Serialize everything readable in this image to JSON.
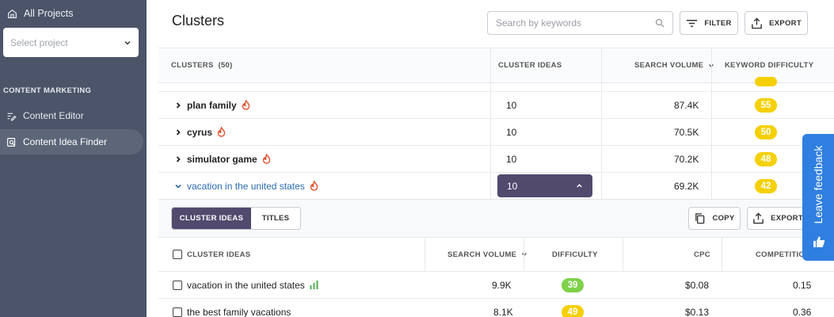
{
  "sidebar": {
    "all_projects": "All Projects",
    "select_project_placeholder": "Select project",
    "section": "CONTENT MARKETING",
    "items": [
      {
        "label": "Content Editor",
        "icon": "edit-lines-icon"
      },
      {
        "label": "Content Idea Finder",
        "icon": "search-doc-icon",
        "active": true
      }
    ]
  },
  "header": {
    "title": "Clusters",
    "search_placeholder": "Search by keywords",
    "filter_label": "FILTER",
    "export_label": "EXPORT"
  },
  "clusters_table": {
    "headers": {
      "clusters": "CLUSTERS",
      "count": "(50)",
      "cluster_ideas": "CLUSTER IDEAS",
      "search_volume": "SEARCH VOLUME",
      "keyword_difficulty": "KEYWORD DIFFICULTY"
    },
    "rows": [
      {
        "keyword": "plan family",
        "ideas": "10",
        "volume": "87.4K",
        "difficulty": "55"
      },
      {
        "keyword": "cyrus",
        "ideas": "10",
        "volume": "70.5K",
        "difficulty": "50"
      },
      {
        "keyword": "simulator game",
        "ideas": "10",
        "volume": "70.2K",
        "difficulty": "48"
      },
      {
        "keyword": "vacation in the united states",
        "ideas": "10",
        "volume": "69.2K",
        "difficulty": "42",
        "expanded": true
      }
    ]
  },
  "details": {
    "tabs": [
      "CLUSTER IDEAS",
      "TITLES"
    ],
    "copy_label": "COPY",
    "export_label": "EXPORT",
    "headers": {
      "cluster_ideas": "CLUSTER IDEAS",
      "search_volume": "SEARCH VOLUME",
      "difficulty": "DIFFICULTY",
      "cpc": "CPC",
      "competition": "COMPETITIO"
    },
    "rows": [
      {
        "keyword": "vacation in the united states",
        "volume": "9.9K",
        "difficulty": "39",
        "cpc": "$0.08",
        "competition": "0.15"
      },
      {
        "keyword": "the best family vacations",
        "volume": "8.1K",
        "difficulty": "49",
        "cpc": "$0.13",
        "competition": "0.36"
      }
    ]
  },
  "feedback": {
    "label": "Leave feedback"
  },
  "colors": {
    "sidebar": "#4b5468",
    "accent": "#514a6d",
    "badge_yellow": "#f5d000",
    "badge_green": "#7fd14a",
    "feedback": "#2f7fe0",
    "link": "#2a6ab2",
    "fire": "#e0532f"
  }
}
